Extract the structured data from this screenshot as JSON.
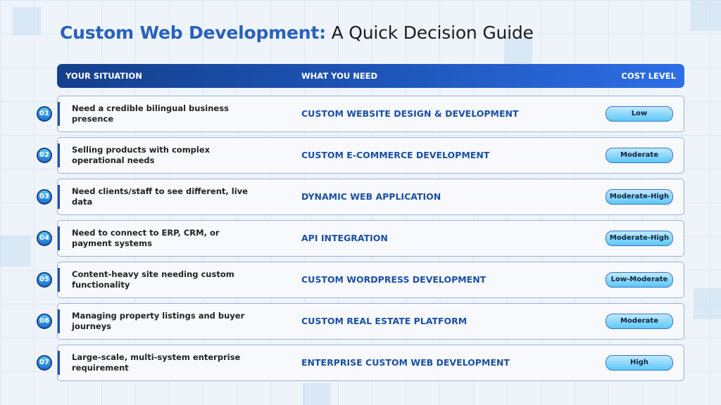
{
  "title": {
    "highlight": "Custom Web Development:",
    "rest": " A Quick Decision Guide"
  },
  "header": {
    "situation": "YOUR SITUATION",
    "need": "WHAT YOU NEED",
    "cost": "COST LEVEL"
  },
  "rows": [
    {
      "num": "01",
      "situation": "Need a credible bilingual business presence",
      "need": "CUSTOM WEBSITE DESIGN & DEVELOPMENT",
      "cost": "Low"
    },
    {
      "num": "02",
      "situation": "Selling products with complex operational needs",
      "need": "CUSTOM E-COMMERCE DEVELOPMENT",
      "cost": "Moderate"
    },
    {
      "num": "03",
      "situation": "Need clients/staff to see different, live data",
      "need": "DYNAMIC WEB APPLICATION",
      "cost": "Moderate-High"
    },
    {
      "num": "04",
      "situation": "Need to connect to ERP, CRM, or payment systems",
      "need": "API INTEGRATION",
      "cost": "Moderate-High"
    },
    {
      "num": "05",
      "situation": "Content-heavy site needing custom functionality",
      "need": "CUSTOM WORDPRESS DEVELOPMENT",
      "cost": "Low-Moderate"
    },
    {
      "num": "06",
      "situation": "Managing property listings and buyer journeys",
      "need": "CUSTOM REAL ESTATE PLATFORM",
      "cost": "Moderate"
    },
    {
      "num": "07",
      "situation": "Large-scale, multi-system enterprise requirement",
      "need": "ENTERPRISE CUSTOM WEB DEVELOPMENT",
      "cost": "High"
    }
  ]
}
